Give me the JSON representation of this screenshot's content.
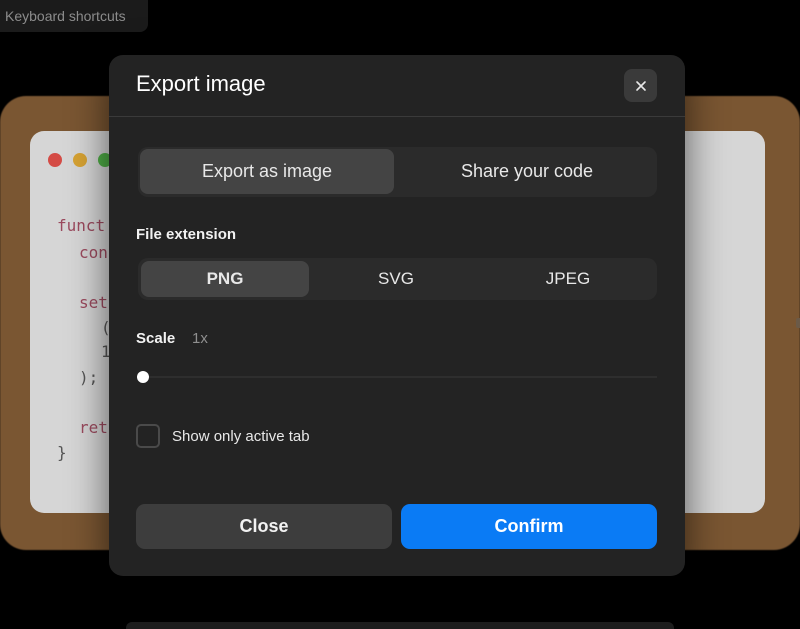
{
  "top_button": {
    "label": "Keyboard shortcuts"
  },
  "background_code": {
    "lines": [
      "funct",
      "con",
      "set",
      "(",
      "1",
      ");",
      "ret",
      "}"
    ]
  },
  "modal": {
    "title": "Export image",
    "close_icon": "close-icon",
    "tabs": [
      {
        "label": "Export as image",
        "active": true
      },
      {
        "label": "Share your code",
        "active": false
      }
    ],
    "file_extension": {
      "label": "File extension",
      "options": [
        {
          "label": "PNG",
          "active": true
        },
        {
          "label": "SVG",
          "active": false
        },
        {
          "label": "JPEG",
          "active": false
        }
      ]
    },
    "scale": {
      "label": "Scale",
      "value": "1x",
      "slider_fraction": 0
    },
    "checkbox": {
      "label": "Show only active tab",
      "checked": false
    },
    "buttons": {
      "close": "Close",
      "confirm": "Confirm"
    }
  },
  "colors": {
    "accent": "#0a7bf5",
    "modal_bg": "#232323",
    "page_bg": "#000000"
  }
}
